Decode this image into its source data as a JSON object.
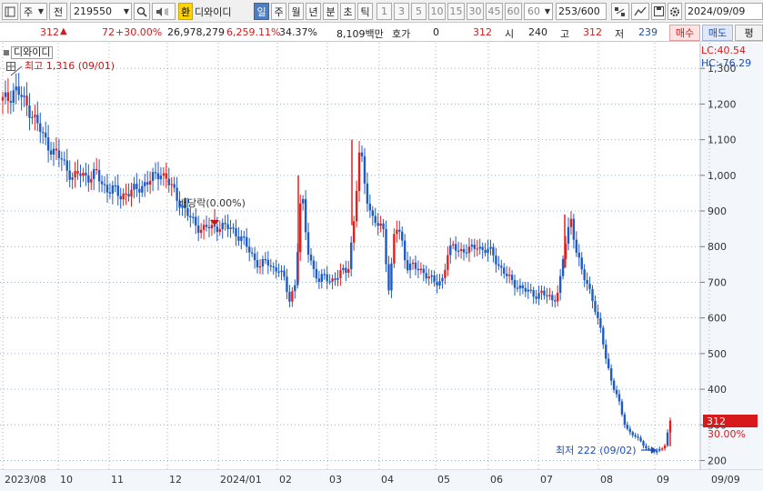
{
  "toolbar": {
    "market": "주",
    "prefix": "전",
    "code": "219550",
    "currency_badge": "환",
    "name": "디와이디",
    "periods": [
      "일",
      "주",
      "월",
      "년",
      "분",
      "초",
      "틱"
    ],
    "intervals": [
      "1",
      "3",
      "5",
      "10",
      "15",
      "30",
      "45",
      "60"
    ],
    "interval_value": "60",
    "count": "253",
    "count_total": "/600",
    "date": "2024/09/09"
  },
  "info": {
    "price": "312",
    "change": "72",
    "change_rate": "+30.00%",
    "volume": "26,978,279",
    "volume_rate": "6,259.11%",
    "turnover": "34.37%",
    "amount": "8,109백만",
    "quote_label": "호가",
    "quote_value": "0",
    "quote_price": "312",
    "open_label": "시",
    "open_value": "240",
    "high_label": "고",
    "high_value": "312",
    "low_label": "저",
    "low_value": "239",
    "buy_label": "매수",
    "sell_label": "매도",
    "eval_label": "평"
  },
  "chart_panel": {
    "legend": "디와이디",
    "lc": "LC:40.54",
    "hc": "HC:-76.29",
    "high_note": "최고 1,316 (09/01)",
    "low_note": "최저 222 (09/02)",
    "dividend_note": "배당락(0.00%)",
    "last_price_tag": "312",
    "last_rate_tag": "30.00%"
  },
  "chart_data": {
    "type": "candlestick",
    "x_labels": [
      "2023/08",
      "10",
      "11",
      "12",
      "2024/01",
      "02",
      "03",
      "04",
      "05",
      "06",
      "07",
      "08",
      "09",
      "09/09"
    ],
    "y_ticks": [
      200,
      300,
      400,
      500,
      600,
      700,
      800,
      900,
      "1,000",
      "1,100",
      "1,200",
      "1,300"
    ],
    "ylim": [
      180,
      1330
    ],
    "close_path": [
      1210,
      1215,
      1245,
      1225,
      1195,
      1175,
      1140,
      1105,
      1080,
      1060,
      1045,
      1020,
      990,
      1005,
      1000,
      995,
      1005,
      975,
      960,
      960,
      940,
      950,
      955,
      960,
      975,
      985,
      995,
      1010,
      990,
      960,
      930,
      905,
      880,
      860,
      850,
      855,
      850,
      860,
      855,
      850,
      835,
      820,
      790,
      765,
      745,
      760,
      740,
      740,
      710,
      650,
      700,
      960,
      800,
      740,
      700,
      720,
      705,
      710,
      730,
      740,
      870,
      1080,
      960,
      880,
      860,
      850,
      670,
      860,
      830,
      745,
      745,
      735,
      730,
      710,
      695,
      705,
      780,
      800,
      790,
      790,
      790,
      805,
      790,
      790,
      770,
      740,
      720,
      700,
      690,
      680,
      670,
      665,
      670,
      660,
      650,
      680,
      800,
      880,
      790,
      720,
      690,
      640,
      570,
      490,
      420,
      380,
      310,
      280,
      270,
      250,
      235,
      225,
      226,
      240,
      312
    ],
    "up_days": [
      1,
      4,
      9,
      13,
      16,
      21,
      25,
      28,
      34,
      37,
      44,
      51,
      60,
      61,
      67,
      76,
      77,
      81,
      96,
      97,
      113,
      114
    ],
    "high": {
      "value": 1316,
      "date": "09/01"
    },
    "low": {
      "value": 222,
      "date": "09/02"
    },
    "last": {
      "value": 312,
      "change_pct": 30.0
    }
  }
}
